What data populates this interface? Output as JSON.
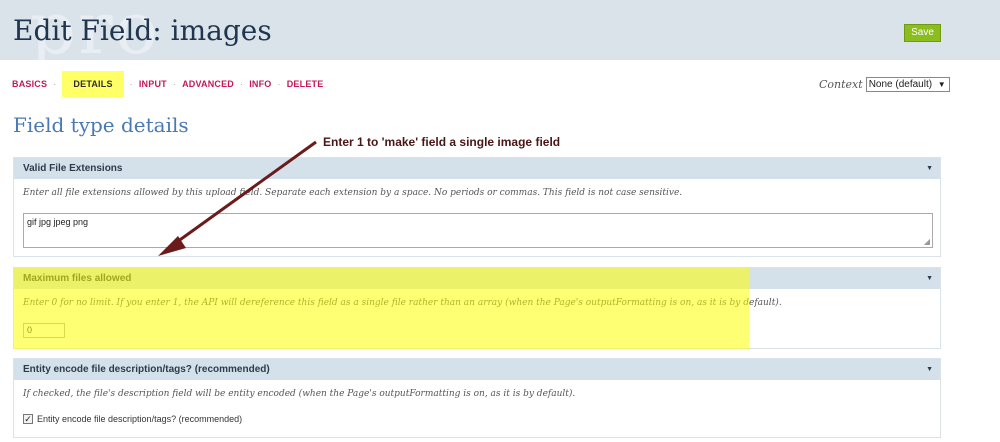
{
  "header": {
    "title": "Edit Field: images",
    "save_label": "Save"
  },
  "tabs": [
    {
      "label": "BASICS",
      "active": false
    },
    {
      "label": "DETAILS",
      "active": true
    },
    {
      "label": "INPUT",
      "active": false
    },
    {
      "label": "ADVANCED",
      "active": false
    },
    {
      "label": "INFO",
      "active": false
    },
    {
      "label": "DELETE",
      "active": false
    }
  ],
  "tab_separator": "·",
  "context": {
    "label": "Context",
    "selected": "None (default)"
  },
  "section_title": "Field type details",
  "annotation": {
    "text": "Enter 1 to 'make' field a single image field",
    "color": "#6b1b1b"
  },
  "panels": {
    "extensions": {
      "title": "Valid File Extensions",
      "description": "Enter all file extensions allowed by this upload field. Separate each extension by a space. No periods or commas. This field is not case sensitive.",
      "value": "gif jpg jpeg png"
    },
    "max_files": {
      "title": "Maximum files allowed",
      "description": "Enter 0 for no limit. If you enter 1, the API will dereference this field as a single file rather than an array (when the Page's outputFormatting is on, as it is by default).",
      "value": "0"
    },
    "entity": {
      "title": "Entity encode file description/tags? (recommended)",
      "description": "If checked, the file's description field will be entity encoded (when the Page's outputFormatting is on, as it is by default).",
      "checkbox_label": "Entity encode file description/tags? (recommended)",
      "checked": true
    }
  },
  "colors": {
    "accent_tab": "#c2185b",
    "save_button": "#8bbd1f",
    "highlight": "#ffff66",
    "panel_header": "#d4e1ea"
  }
}
